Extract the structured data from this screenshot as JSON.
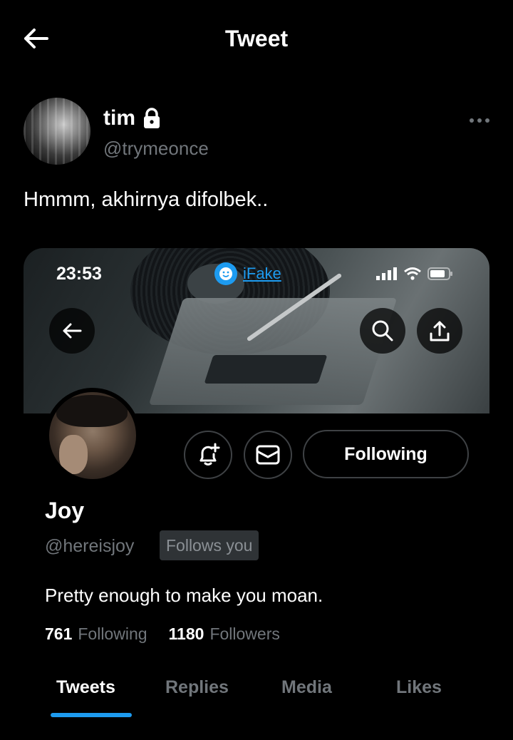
{
  "header": {
    "title": "Tweet",
    "back_icon": "arrow-left-icon"
  },
  "tweet": {
    "author_name": "tim",
    "author_handle": "@trymeonce",
    "locked": true,
    "text": "Hmmm, akhirnya difolbek.."
  },
  "embedded_profile": {
    "status_bar": {
      "time": "23:53",
      "app_label": "iFake"
    },
    "name": "Joy",
    "handle": "@hereisjoy",
    "follows_you_badge": "Follows you",
    "bio": "Pretty enough to make you moan.",
    "following_count": "761",
    "following_label": "Following",
    "followers_count": "1180",
    "followers_label": "Followers",
    "following_button_label": "Following",
    "tabs": [
      {
        "label": "Tweets",
        "active": true
      },
      {
        "label": "Replies",
        "active": false
      },
      {
        "label": "Media",
        "active": false
      },
      {
        "label": "Likes",
        "active": false
      }
    ]
  },
  "colors": {
    "background": "#000000",
    "accent": "#1d9bf0",
    "muted_text": "#71767b",
    "primary_text": "#ffffff"
  }
}
